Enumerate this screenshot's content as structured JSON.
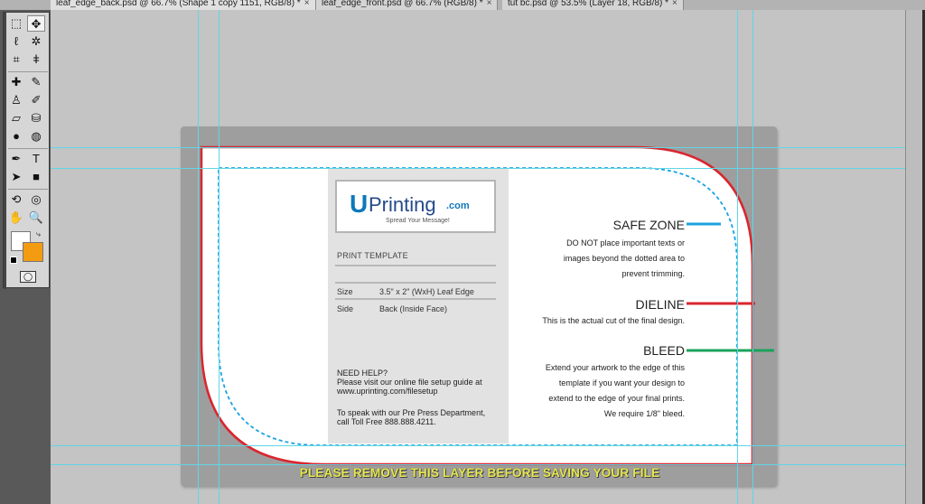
{
  "tabs": [
    {
      "title": "leaf_edge_back.psd @ 66.7% (Shape 1 copy 1151, RGB/8) *",
      "close": "×"
    },
    {
      "title": "leaf_edge_front.psd @ 66.7% (RGB/8) *",
      "close": "×"
    },
    {
      "title": "tut bc.psd @ 53.5% (Layer 18, RGB/8) *",
      "close": "×"
    }
  ],
  "tools": [
    {
      "icon": "rect-marquee-icon",
      "glyph": "⬚"
    },
    {
      "icon": "move-icon",
      "glyph": "✥"
    },
    {
      "icon": "lasso-icon",
      "glyph": "ℓ"
    },
    {
      "icon": "magic-wand-icon",
      "glyph": "✲"
    },
    {
      "icon": "crop-icon",
      "glyph": "⌗"
    },
    {
      "icon": "eyedropper-icon",
      "glyph": "ǂ"
    },
    {
      "icon": "healing-icon",
      "glyph": "✚"
    },
    {
      "icon": "brush-icon",
      "glyph": "✎"
    },
    {
      "icon": "stamp-icon",
      "glyph": "♙"
    },
    {
      "icon": "history-brush-icon",
      "glyph": "✐"
    },
    {
      "icon": "eraser-icon",
      "glyph": "▱"
    },
    {
      "icon": "bucket-icon",
      "glyph": "⛁"
    },
    {
      "icon": "blur-icon",
      "glyph": "●"
    },
    {
      "icon": "dodge-icon",
      "glyph": "◍"
    },
    {
      "icon": "pen-icon",
      "glyph": "✒"
    },
    {
      "icon": "type-icon",
      "glyph": "T"
    },
    {
      "icon": "path-select-icon",
      "glyph": "➤"
    },
    {
      "icon": "shape-icon",
      "glyph": "■"
    },
    {
      "icon": "3d-rotate-icon",
      "glyph": "⟲"
    },
    {
      "icon": "3d-orbit-icon",
      "glyph": "◎"
    },
    {
      "icon": "hand-icon",
      "glyph": "✋"
    },
    {
      "icon": "zoom-icon",
      "glyph": "🔍"
    }
  ],
  "colors": {
    "foreground": "#ffffff",
    "background": "#f39c12",
    "safe": "#1aa3e0",
    "dieline": "#d9262e",
    "bleed": "#1aa35a"
  },
  "card": {
    "logo": {
      "u": "U",
      "word": "Printing",
      "tm": "™",
      "com": ".com",
      "tagline": "Spread Your Message!"
    },
    "print_template": "PRINT TEMPLATE",
    "specs": [
      {
        "key": "Size",
        "value": "3.5\" x 2\"  (WxH) Leaf Edge"
      },
      {
        "key": "Side",
        "value": "Back (Inside Face)"
      }
    ],
    "help1": "NEED HELP?",
    "help2": "Please visit our online file setup guide at",
    "help3": "www.uprinting.com/filesetup",
    "help4": "To speak with our Pre Press Department,",
    "help5": "call Toll Free 888.888.4211."
  },
  "zones": {
    "safe": {
      "title": "SAFE ZONE",
      "lines": [
        "DO NOT place important texts or",
        "images beyond the dotted area to",
        "prevent trimming."
      ]
    },
    "dieline": {
      "title": "DIELINE",
      "lines": [
        "This is the actual cut of the final design."
      ]
    },
    "bleed": {
      "title": "BLEED",
      "lines": [
        "Extend your artwork to the edge of this",
        "template if you want your design to",
        "extend to the edge of your final prints.",
        "We require 1/8\" bleed."
      ]
    }
  },
  "warning": "PLEASE REMOVE THIS LAYER BEFORE SAVING YOUR FILE"
}
